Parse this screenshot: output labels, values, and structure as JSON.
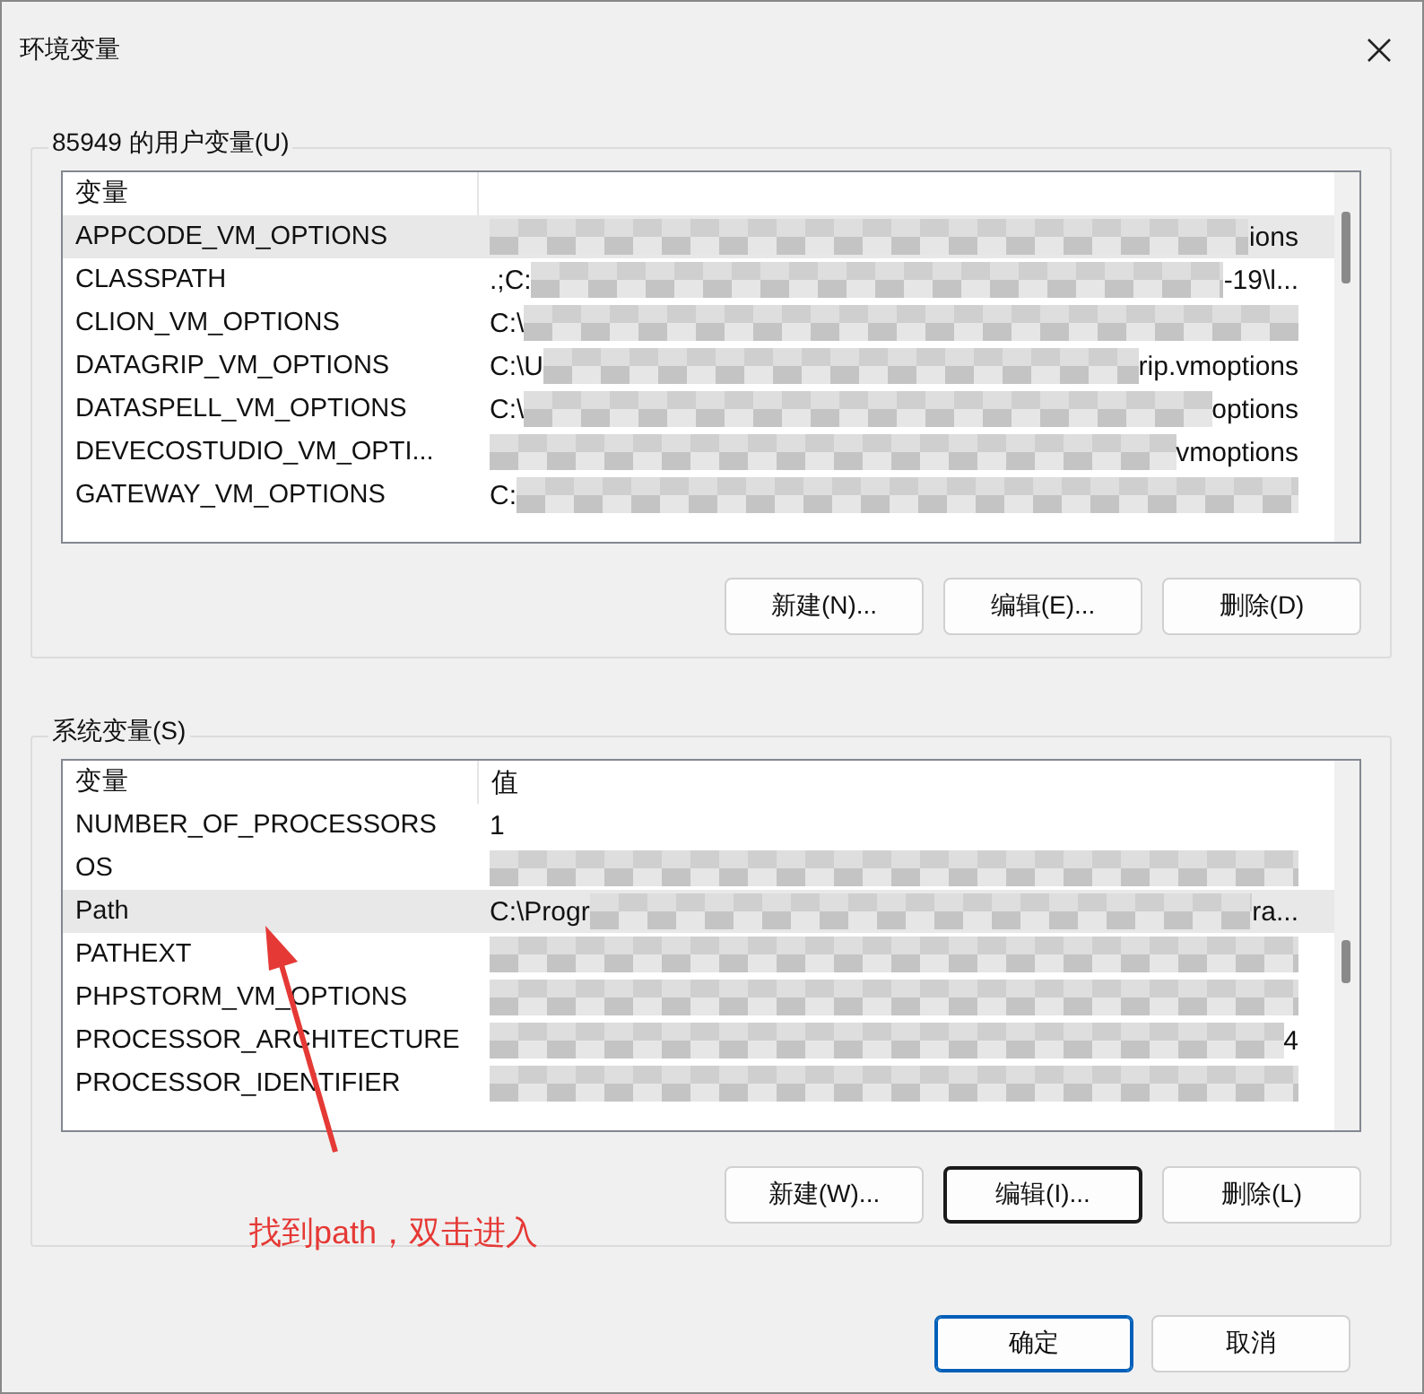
{
  "window": {
    "title": "环境变量"
  },
  "user_vars": {
    "title": "85949 的用户变量(U)",
    "columns": [
      "变量"
    ],
    "rows": [
      {
        "name": "APPCODE_VM_OPTIONS",
        "value_start": "",
        "value_end": "ions",
        "redacted": true,
        "selected": true
      },
      {
        "name": "CLASSPATH",
        "value_start": ".;C:",
        "value_end": "-19\\l...",
        "redacted": true,
        "selected": false
      },
      {
        "name": "CLION_VM_OPTIONS",
        "value_start": "C:\\",
        "value_end": "",
        "redacted": true,
        "selected": false
      },
      {
        "name": "DATAGRIP_VM_OPTIONS",
        "value_start": "C:\\U",
        "value_end": "rip.vmoptions",
        "redacted": true,
        "selected": false
      },
      {
        "name": "DATASPELL_VM_OPTIONS",
        "value_start": "C:\\",
        "value_end": "options",
        "redacted": true,
        "selected": false
      },
      {
        "name": "DEVECOSTUDIO_VM_OPTI...",
        "value_start": "",
        "value_end": "vmoptions",
        "redacted": true,
        "selected": false
      },
      {
        "name": "GATEWAY_VM_OPTIONS",
        "value_start": "C:",
        "value_end": "",
        "redacted": true,
        "selected": false
      }
    ],
    "buttons": [
      {
        "label": "新建(N)...",
        "focused": false
      },
      {
        "label": "编辑(E)...",
        "focused": false
      },
      {
        "label": "删除(D)",
        "focused": false
      }
    ]
  },
  "system_vars": {
    "title": "系统变量(S)",
    "columns": [
      "变量",
      "值"
    ],
    "rows": [
      {
        "name": "NUMBER_OF_PROCESSORS",
        "value_start": "1",
        "value_end": "",
        "redacted": false,
        "selected": false
      },
      {
        "name": "OS",
        "value_start": "",
        "value_end": "",
        "redacted": true,
        "selected": false
      },
      {
        "name": "Path",
        "value_start": "C:\\Progr",
        "value_end": "ra...",
        "redacted": true,
        "selected": true
      },
      {
        "name": "PATHEXT",
        "value_start": "",
        "value_end": "",
        "redacted": true,
        "selected": false
      },
      {
        "name": "PHPSTORM_VM_OPTIONS",
        "value_start": "",
        "value_end": "",
        "redacted": true,
        "selected": false
      },
      {
        "name": "PROCESSOR_ARCHITECTURE",
        "value_start": "",
        "value_end": "4",
        "redacted": true,
        "selected": false
      },
      {
        "name": "PROCESSOR_IDENTIFIER",
        "value_start": "",
        "value_end": "",
        "redacted": true,
        "selected": false
      }
    ],
    "buttons": [
      {
        "label": "新建(W)...",
        "focused": false
      },
      {
        "label": "编辑(I)...",
        "focused": true
      },
      {
        "label": "删除(L)",
        "focused": false
      }
    ]
  },
  "footer_buttons": [
    {
      "label": "确定",
      "default": true
    },
    {
      "label": "取消",
      "default": false
    }
  ],
  "annotation": {
    "text": "找到path，双击进入"
  }
}
